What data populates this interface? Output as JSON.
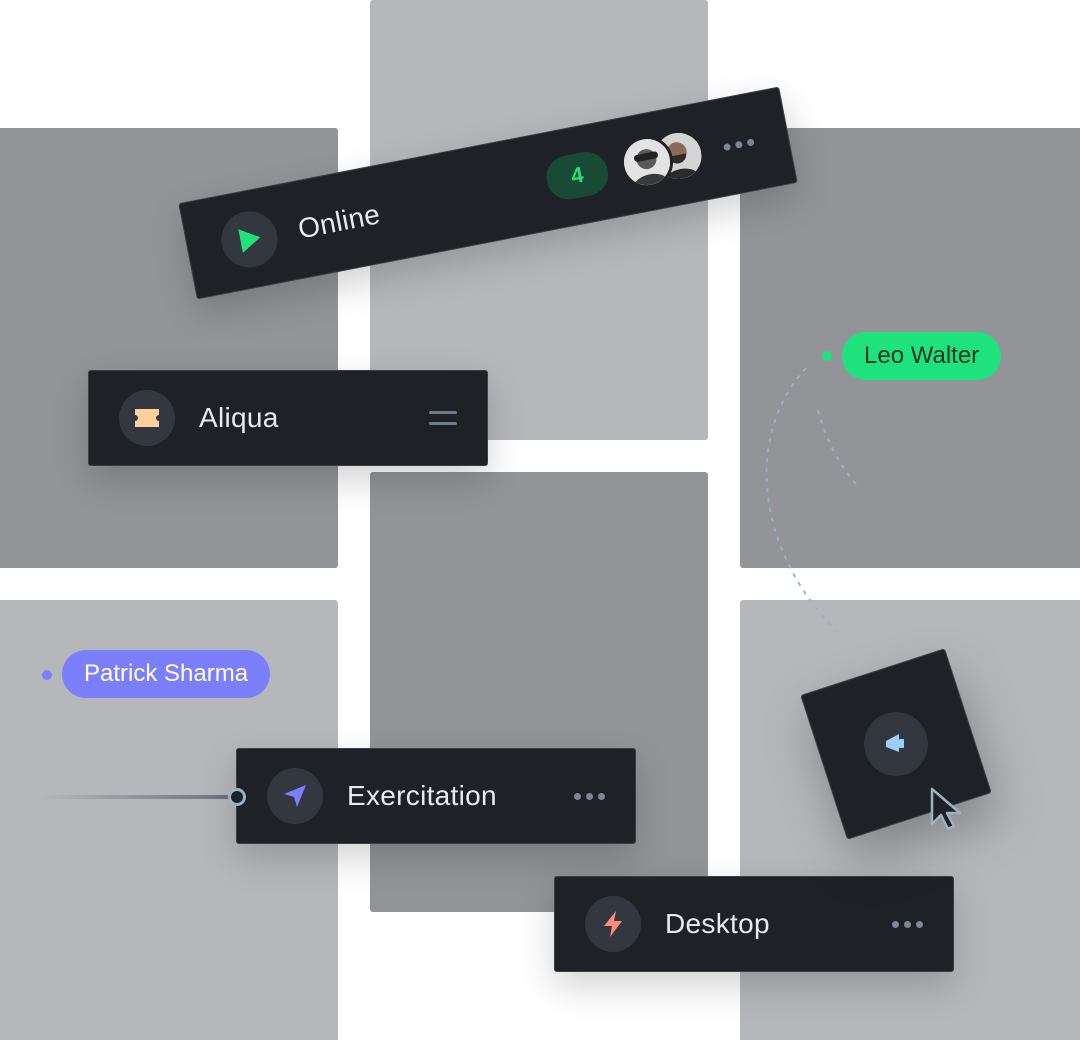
{
  "colors": {
    "tile_light": "#b6b7ba",
    "tile_dark": "#939497",
    "card_bg": "#1e2126",
    "accent_green": "#1ee27c",
    "accent_purple": "#7b7ffc",
    "accent_coral": "#ff8b80",
    "accent_peach": "#ffcf9c",
    "accent_blue": "#9ccdfb"
  },
  "online_card": {
    "label": "Online",
    "icon": "play-icon",
    "badge_count": "4",
    "avatars": [
      "avatar-woman-with-goggles",
      "avatar-bearded-man"
    ],
    "menu_icon": "more-horizontal-icon"
  },
  "aliqua_card": {
    "label": "Aliqua",
    "icon": "ticket-icon",
    "menu_icon": "menu-lines-icon"
  },
  "exercitation_card": {
    "label": "Exercitation",
    "icon": "navigation-arrow-icon",
    "menu_icon": "more-horizontal-icon"
  },
  "desktop_card": {
    "label": "Desktop",
    "icon": "lightning-icon",
    "menu_icon": "more-horizontal-icon"
  },
  "drag_card": {
    "icon": "megaphone-icon",
    "cursor": "mouse-cursor-icon"
  },
  "collaborators": {
    "leo": "Leo Walter",
    "patrick": "Patrick Sharma"
  }
}
